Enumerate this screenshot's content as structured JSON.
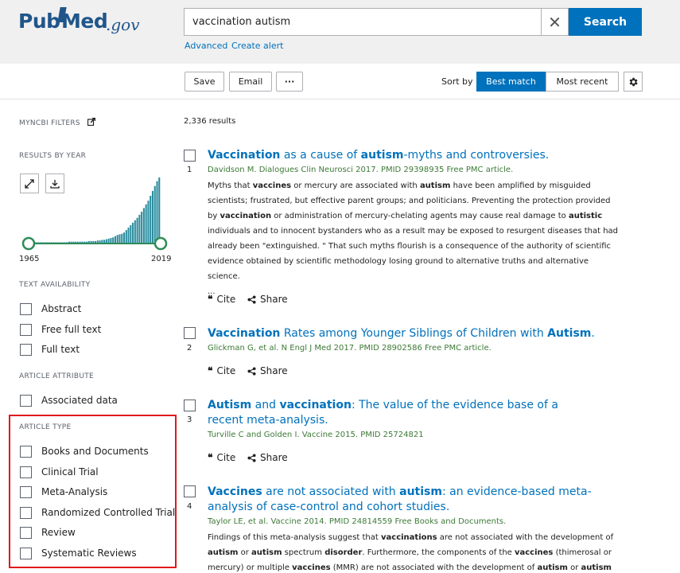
{
  "header": {
    "logo_pub": "Pub",
    "logo_med": "Med",
    "logo_gov": ".gov",
    "search_value": "vaccination autism",
    "search_button": "Search",
    "advanced_link": "Advanced",
    "create_alert_link": "Create alert"
  },
  "toolbar": {
    "save": "Save",
    "email": "Email",
    "more": "···",
    "sort_by": "Sort by",
    "best_match": "Best match",
    "most_recent": "Most recent"
  },
  "sidebar": {
    "myncbi_filters": "MYNCBI FILTERS",
    "results_by_year": "RESULTS BY YEAR",
    "year_start": "1965",
    "year_end": "2019",
    "text_availability": "TEXT AVAILABILITY",
    "text_filters": [
      "Abstract",
      "Free full text",
      "Full text"
    ],
    "article_attribute": "ARTICLE ATTRIBUTE",
    "attribute_filters": [
      "Associated data"
    ],
    "article_type": "ARTICLE TYPE",
    "type_filters": [
      "Books and Documents",
      "Clinical Trial",
      "Meta-Analysis",
      "Randomized Controlled Trial",
      "Review",
      "Systematic Reviews"
    ]
  },
  "histogram": {
    "counts": [
      2,
      2,
      2,
      2,
      2,
      2,
      2,
      2,
      2,
      2,
      2,
      2,
      2,
      2,
      2,
      2,
      2,
      2,
      3,
      3,
      3,
      3,
      3,
      3,
      3,
      3,
      3,
      4,
      4,
      4,
      4,
      5,
      5,
      6,
      6,
      7,
      8,
      9,
      10,
      12,
      14,
      15,
      16,
      18,
      22,
      26,
      30,
      34,
      38,
      42,
      47,
      52,
      58,
      64,
      70,
      78,
      86,
      94,
      102,
      108
    ]
  },
  "results": {
    "count": "2,336 results",
    "cite": "Cite",
    "share": "Share",
    "items": [
      {
        "num": "1",
        "t1": "Vaccination",
        "t2": " as a cause of ",
        "t3": "autism",
        "t4": "-myths and controversies.",
        "citation": "Davidson M. Dialogues Clin Neurosci 2017. PMID 29398935 Free PMC article.",
        "s1": "Myths that ",
        "s2": "vaccines",
        "s3": " or mercury are associated with ",
        "s4": "autism",
        "s5": " have been amplified by misguided scientists; frustrated, but effective parent groups; and politicians. Preventing the protection provided by ",
        "s6": "vaccination",
        "s7": " or administration of mercury-chelating agents may cause real damage to ",
        "s8": "autistic",
        "s9": " individuals and to innocent bystanders who as a result may be exposed to resurgent diseases that had already been \"extinguished. \" That such myths flourish is a consequence of the authority of scientific evidence obtained by scientific methodology losing ground to alternative truths and alternative science.",
        "ellipsis": "..."
      },
      {
        "num": "2",
        "t1": "Vaccination",
        "t2": " Rates among Younger Siblings of Children with ",
        "t3": "Autism",
        "t4": ".",
        "citation": "Glickman G, et al. N Engl J Med 2017. PMID 28902586 Free PMC article."
      },
      {
        "num": "3",
        "t1": "Autism",
        "t2": " and ",
        "t3": "vaccination",
        "t4": ": The value of the evidence base of a recent meta-analysis.",
        "citation": "Turville C and Golden I. Vaccine 2015. PMID 25724821"
      },
      {
        "num": "4",
        "t1": "Vaccines",
        "t2": " are not associated with ",
        "t3": "autism",
        "t4": ": an evidence-based meta-analysis of case-control and cohort studies.",
        "citation": "Taylor LE, et al. Vaccine 2014. PMID 24814559 Free Books and Documents.",
        "s1": "Findings of this meta-analysis suggest that ",
        "s2": "vaccinations",
        "s3": " are not associated with the development of ",
        "s4": "autism",
        "s5": " or ",
        "s6": "autism",
        "s7": " spectrum ",
        "s8": "disorder",
        "s9": ". Furthermore, the components of the ",
        "s10": "vaccines",
        "s11": " (thimerosal or mercury) or multiple ",
        "s12": "vaccines",
        "s13": " (MMR) are not associated with the development of ",
        "s14": "autism",
        "s15": " or ",
        "s16": "autism"
      }
    ]
  }
}
